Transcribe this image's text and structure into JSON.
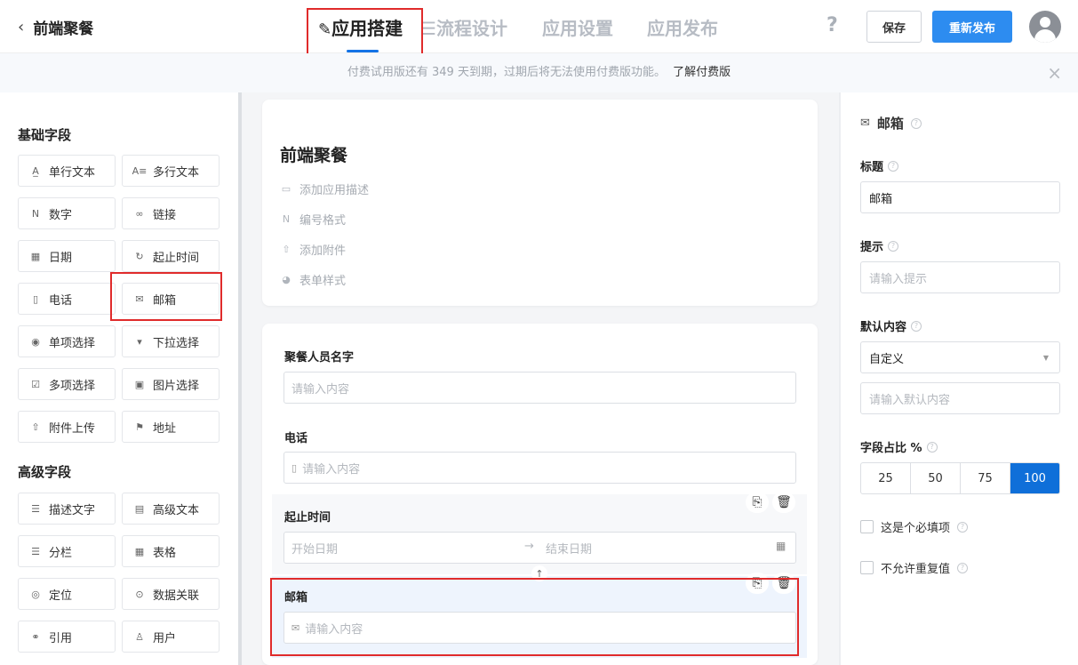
{
  "header": {
    "back_icon": "chevron-left-icon",
    "app_name": "前端聚餐",
    "tabs": [
      {
        "label": "应用搭建",
        "icon": "edit-icon",
        "active": true
      },
      {
        "label": "流程设计",
        "icon": "flow-icon",
        "active": false
      },
      {
        "label": "应用设置",
        "active": false
      },
      {
        "label": "应用发布",
        "active": false
      }
    ],
    "help": "?",
    "save_label": "保存",
    "publish_label": "重新发布"
  },
  "notice": {
    "text": "付费试用版还有 349 天到期，过期后将无法使用付费版功能。",
    "link": "了解付费版",
    "close": "×"
  },
  "left": {
    "basic_title": "基础字段",
    "advanced_title": "高级字段",
    "basic_fields": [
      {
        "label": "单行文本",
        "icon": "A̲"
      },
      {
        "label": "多行文本",
        "icon": "A≡"
      },
      {
        "label": "数字",
        "icon": "N"
      },
      {
        "label": "链接",
        "icon": "∞"
      },
      {
        "label": "日期",
        "icon": "▦"
      },
      {
        "label": "起止时间",
        "icon": "↻"
      },
      {
        "label": "电话",
        "icon": "▯"
      },
      {
        "label": "邮箱",
        "icon": "✉"
      },
      {
        "label": "单项选择",
        "icon": "◉"
      },
      {
        "label": "下拉选择",
        "icon": "▾"
      },
      {
        "label": "多项选择",
        "icon": "☑"
      },
      {
        "label": "图片选择",
        "icon": "▣"
      },
      {
        "label": "附件上传",
        "icon": "⇧"
      },
      {
        "label": "地址",
        "icon": "⚑"
      }
    ],
    "advanced_fields": [
      {
        "label": "描述文字",
        "icon": "☰"
      },
      {
        "label": "高级文本",
        "icon": "▤"
      },
      {
        "label": "分栏",
        "icon": "☰"
      },
      {
        "label": "表格",
        "icon": "▦"
      },
      {
        "label": "定位",
        "icon": "◎"
      },
      {
        "label": "数据关联",
        "icon": "⊙"
      },
      {
        "label": "引用",
        "icon": "⚭"
      },
      {
        "label": "用户",
        "icon": "♙"
      }
    ]
  },
  "form_header": {
    "title": "前端聚餐",
    "items": [
      {
        "label": "添加应用描述",
        "icon": "▭"
      },
      {
        "label": "编号格式",
        "icon": "N"
      },
      {
        "label": "添加附件",
        "icon": "⇧"
      },
      {
        "label": "表单样式",
        "icon": "◕"
      }
    ]
  },
  "form_fields": {
    "name": {
      "label": "聚餐人员名字",
      "placeholder": "请输入内容"
    },
    "phone": {
      "label": "电话",
      "placeholder": "请输入内容",
      "icon": "▯"
    },
    "range": {
      "label": "起止时间",
      "start": "开始日期",
      "sep": "→",
      "end": "结束日期"
    },
    "email": {
      "label": "邮箱",
      "placeholder": "请输入内容",
      "icon": "✉"
    }
  },
  "right": {
    "title": "邮箱",
    "title_label": "标题",
    "title_value": "邮箱",
    "hint_label": "提示",
    "hint_placeholder": "请输入提示",
    "default_label": "默认内容",
    "default_select": "自定义",
    "default_placeholder": "请输入默认内容",
    "ratio_label": "字段占比 %",
    "ratio_options": [
      "25",
      "50",
      "75",
      "100"
    ],
    "ratio_selected": "100",
    "required_label": "这是个必填项",
    "unique_label": "不允许重复值",
    "help_mark": "?"
  },
  "colors": {
    "accent": "#1473e6",
    "publish": "#2d8cf0",
    "highlight": "#e02b2b",
    "ratio_selected": "#0f6fd9"
  }
}
